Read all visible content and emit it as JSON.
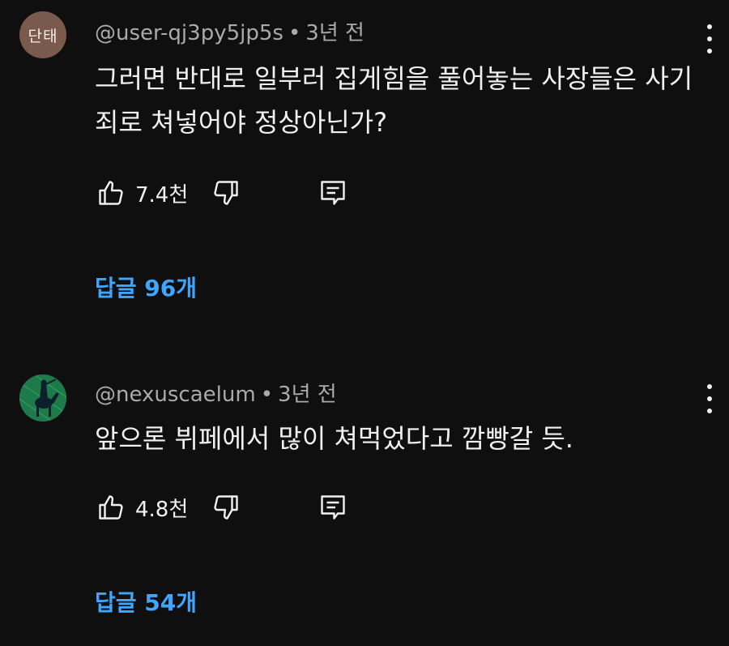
{
  "comments": [
    {
      "avatar_text": "단태",
      "author": "@user-qj3py5jp5s",
      "separator": "•",
      "time": "3년 전",
      "text": "그러면 반대로 일부러 집게힘을 풀어놓는 사장들은 사기죄로 쳐넣어야 정상아닌가?",
      "likes": "7.4천",
      "replies": "답글 96개",
      "avatar_color": "#7b5a4e"
    },
    {
      "avatar_text": "",
      "author": "@nexuscaelum",
      "separator": "•",
      "time": "3년 전",
      "text": "앞으론 뷔페에서 많이 쳐먹었다고 깜빵갈 듯.",
      "likes": "4.8천",
      "replies": "답글 54개",
      "avatar_color": "#1e7a4a"
    }
  ],
  "colors": {
    "background": "#0f0f0f",
    "meta": "#aaaaaa",
    "link": "#3ea6ff"
  },
  "icons": {
    "like": "thumbs-up-icon",
    "dislike": "thumbs-down-icon",
    "reply": "comment-reply-icon",
    "more": "more-vert-icon"
  }
}
